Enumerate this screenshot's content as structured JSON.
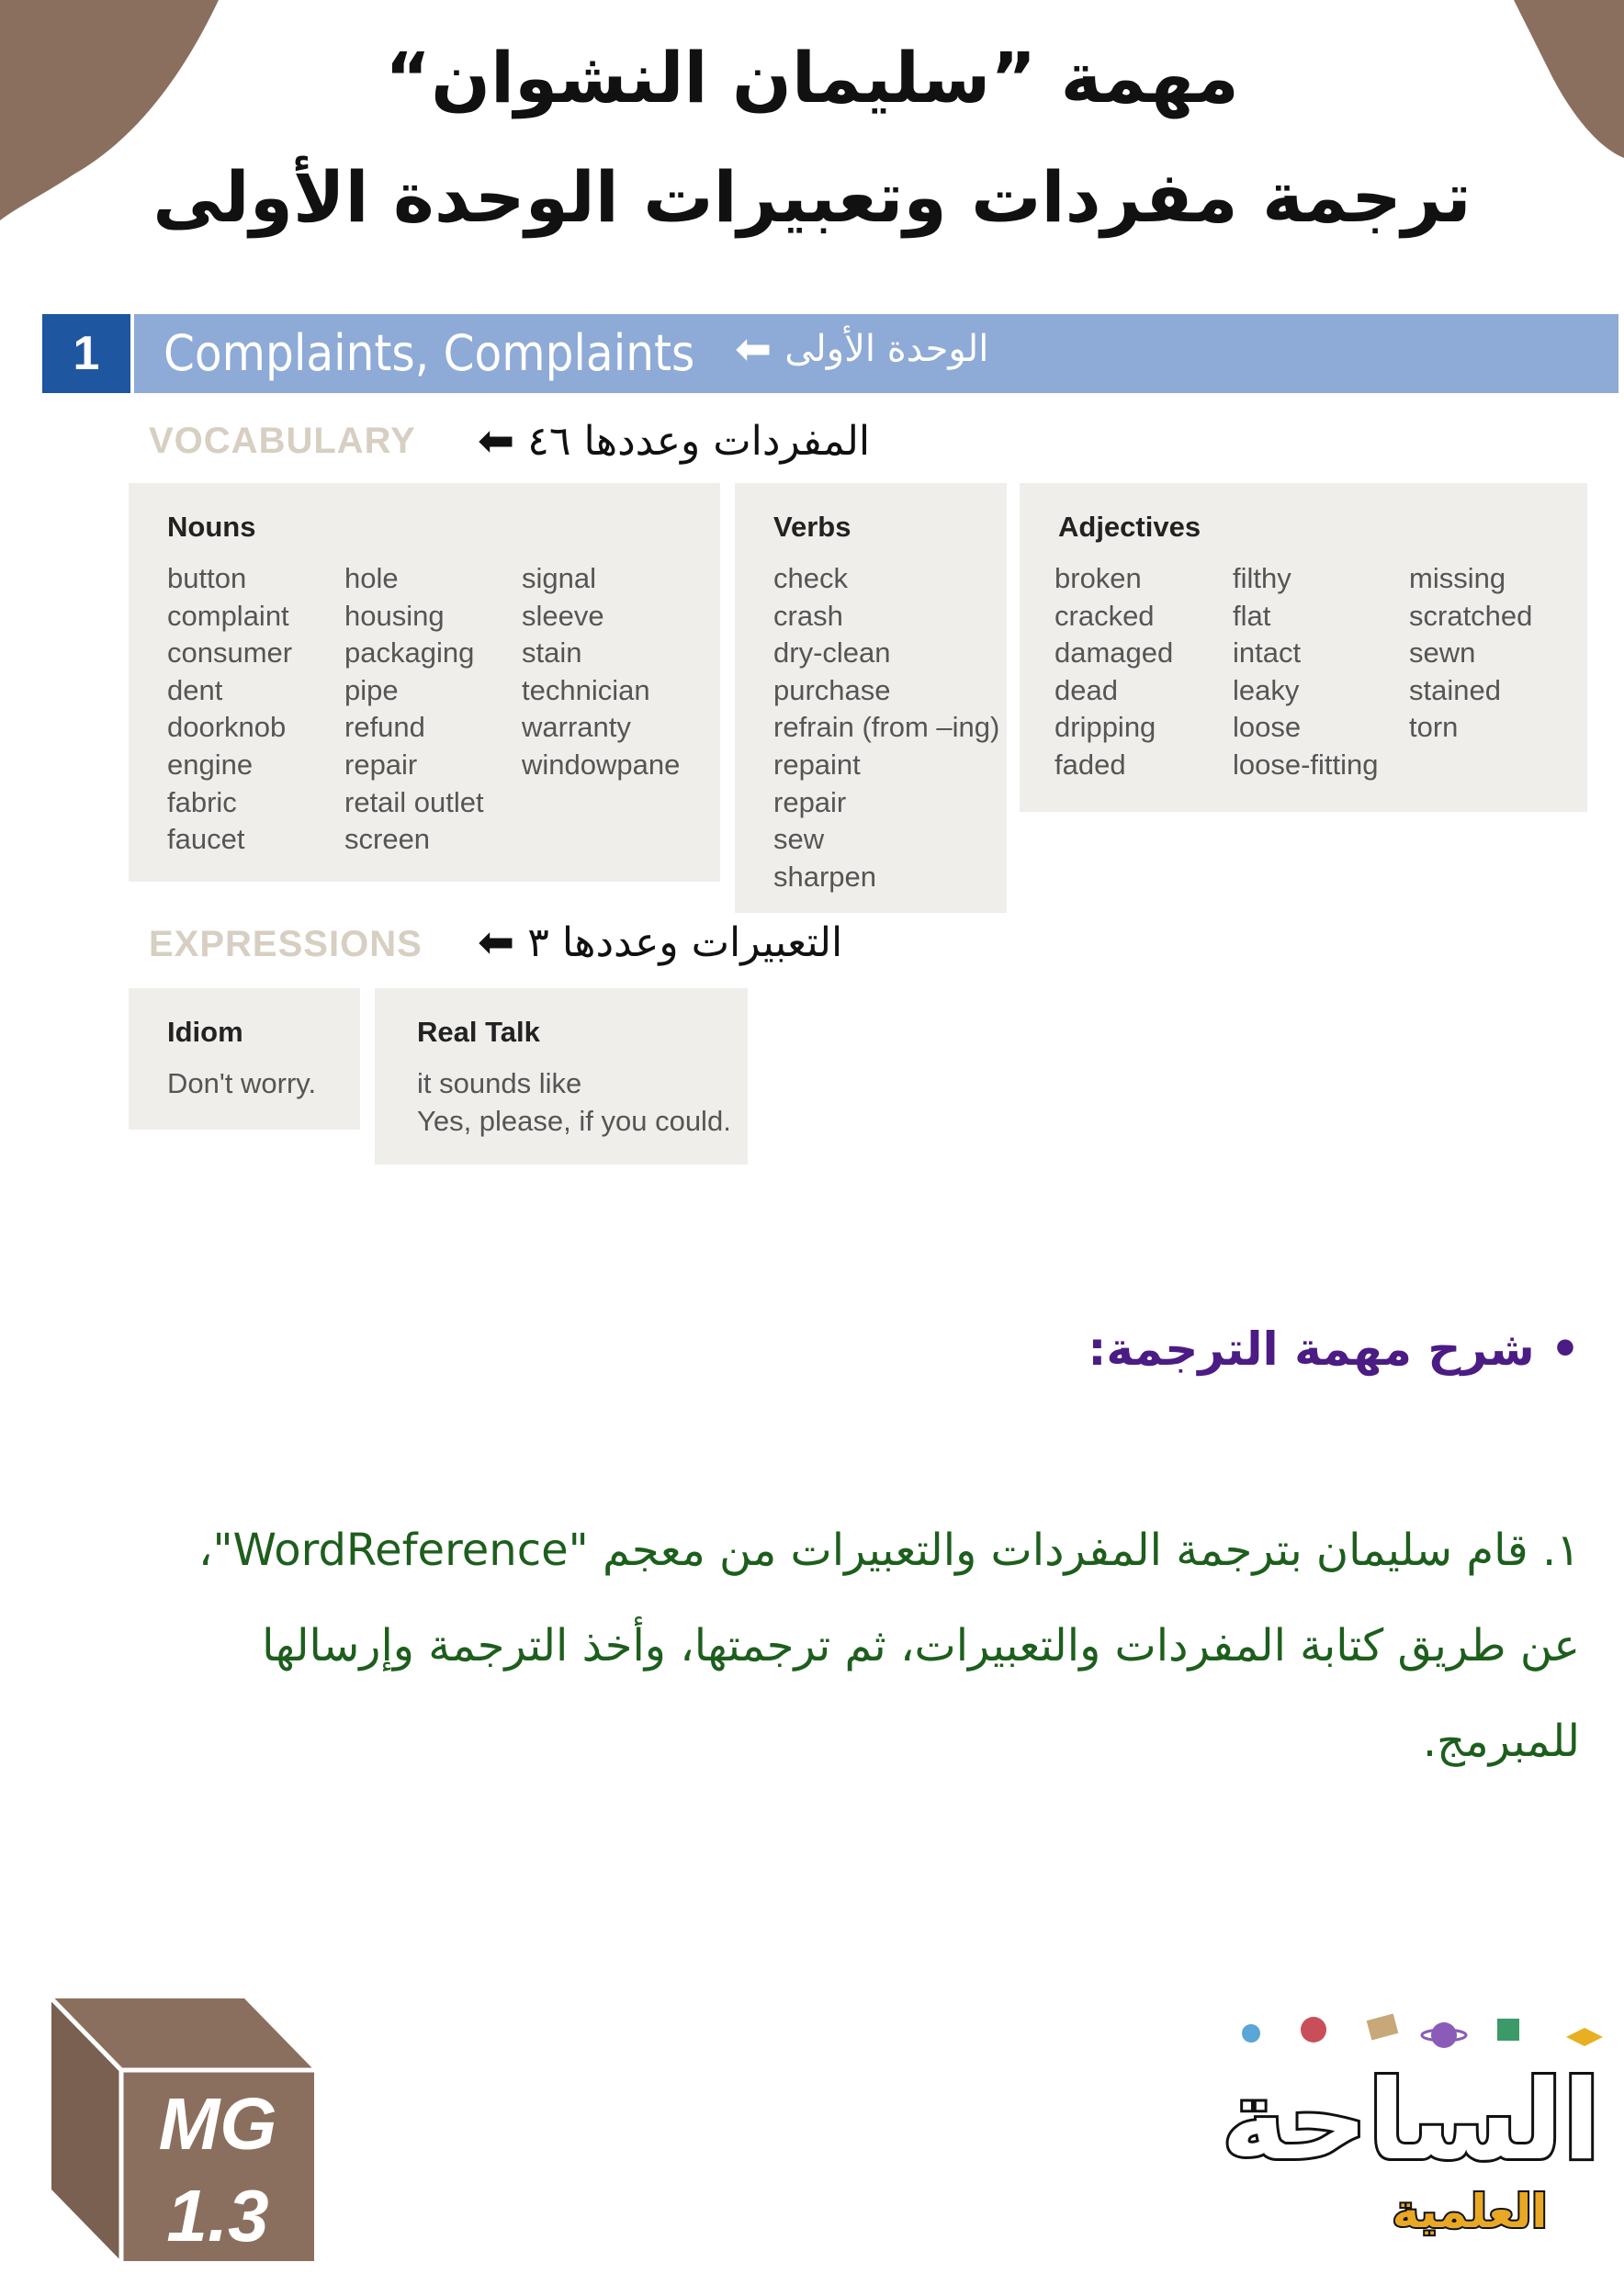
{
  "header": {
    "line1": "مهمة ”سليمان النشوان“",
    "line2": "ترجمة مفردات وتعبيرات الوحدة الأولى"
  },
  "unit": {
    "number": "1",
    "title": "Complaints, Complaints",
    "note": "الوحدة الأولى",
    "arrow": "⬅"
  },
  "vocabulary": {
    "label": "VOCABULARY",
    "note": "المفردات وعددها ٤٦",
    "arrow": "⬅",
    "nouns": {
      "heading": "Nouns",
      "columns": [
        [
          "button",
          "complaint",
          "consumer",
          "dent",
          "doorknob",
          "engine",
          "fabric",
          "faucet"
        ],
        [
          "hole",
          "housing",
          "packaging",
          "pipe",
          "refund",
          "repair",
          "retail outlet",
          "screen"
        ],
        [
          "signal",
          "sleeve",
          "stain",
          "technician",
          "warranty",
          "windowpane"
        ]
      ]
    },
    "verbs": {
      "heading": "Verbs",
      "items": [
        "check",
        "crash",
        "dry-clean",
        "purchase",
        "refrain (from –ing)",
        "repaint",
        "repair",
        "sew",
        "sharpen"
      ]
    },
    "adjectives": {
      "heading": "Adjectives",
      "columns": [
        [
          "broken",
          "cracked",
          "damaged",
          "dead",
          "dripping",
          "faded"
        ],
        [
          "filthy",
          "flat",
          "intact",
          "leaky",
          "loose",
          "loose-fitting"
        ],
        [
          "missing",
          "scratched",
          "sewn",
          "stained",
          "torn"
        ]
      ]
    }
  },
  "expressions": {
    "label": "EXPRESSIONS",
    "note": "التعبيرات وعددها ٣",
    "arrow": "⬅",
    "idiom": {
      "heading": "Idiom",
      "items": [
        "Don't worry."
      ]
    },
    "real_talk": {
      "heading": "Real Talk",
      "items": [
        "it sounds like",
        "Yes, please, if you could."
      ]
    }
  },
  "explanation": {
    "title": "• شرح مهمة الترجمة:",
    "lines": [
      "١. قام سليمان بترجمة المفردات والتعبيرات من معجم \"WordReference\"،",
      "عن طريق كتابة المفردات والتعبيرات، ثم ترجمتها، وأخذ الترجمة وإرسالها",
      "للمبرمج."
    ]
  },
  "logos": {
    "mg": {
      "line1": "MG",
      "line2": "1.3"
    },
    "site": {
      "main": "الساحة",
      "sub": "العلمية"
    }
  },
  "colors": {
    "corner_brown": "#8b6f5e",
    "unit_blue": "#1e56a0",
    "title_bar": "#8eaad6",
    "box_gray": "#efeeeb",
    "purple": "#4b1c84",
    "green": "#1d5e1d"
  }
}
